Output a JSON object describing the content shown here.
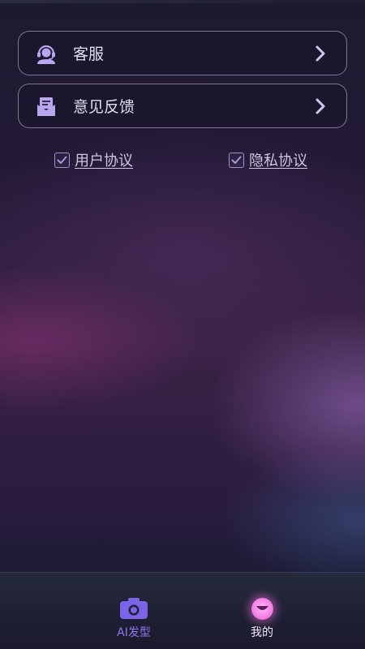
{
  "menu": {
    "items": [
      {
        "label": "客服",
        "icon": "customer-service-icon"
      },
      {
        "label": "意见反馈",
        "icon": "feedback-mail-icon"
      }
    ]
  },
  "agreements": {
    "user": {
      "label": "用户协议",
      "checked": true
    },
    "privacy": {
      "label": "隐私协议",
      "checked": true
    }
  },
  "tabbar": {
    "tabs": [
      {
        "label": "AI发型",
        "icon": "camera-icon",
        "active": false
      },
      {
        "label": "我的",
        "icon": "smile-face-icon",
        "active": true
      }
    ]
  },
  "colors": {
    "accent": "#8f76f0",
    "active_tab": "#f57fe6",
    "card_border": "#d2c8e6"
  }
}
